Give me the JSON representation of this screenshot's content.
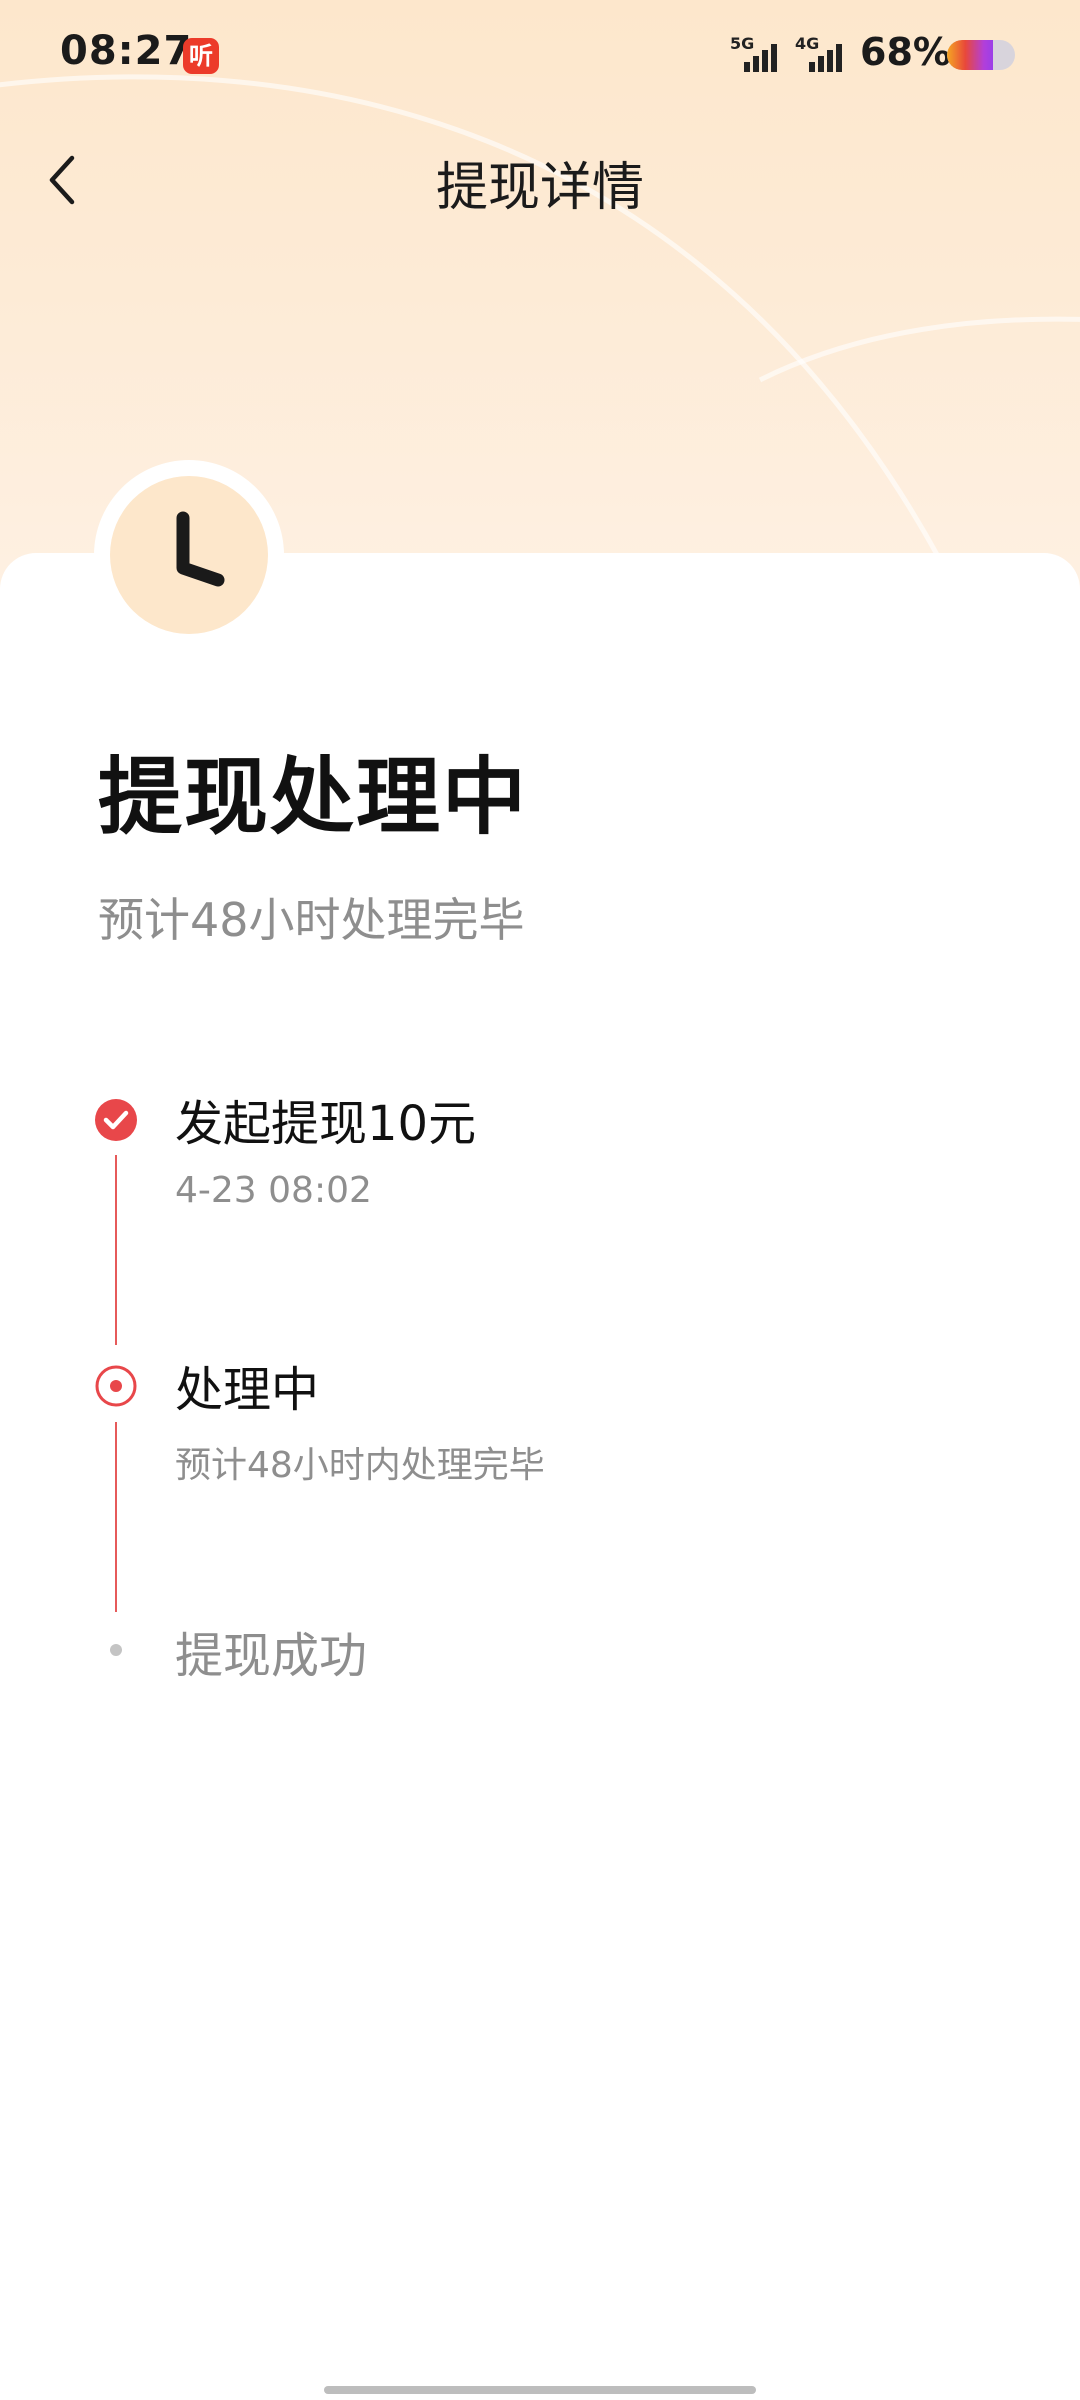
{
  "status_bar": {
    "time": "08:27",
    "app_badge": "听",
    "net1": "5G",
    "net2": "4G",
    "battery_pct": "68%",
    "battery_level": 0.68
  },
  "header": {
    "title": "提现详情"
  },
  "status": {
    "title": "提现处理中",
    "subtitle": "预计48小时处理完毕"
  },
  "timeline": [
    {
      "title": "发起提现10元",
      "sub": "4-23 08:02",
      "state": "done"
    },
    {
      "title": "处理中",
      "sub": "预计48小时内处理完毕",
      "state": "current"
    },
    {
      "title": "提现成功",
      "sub": "",
      "state": "pending"
    }
  ],
  "colors": {
    "accent": "#e8474a",
    "header_bg": "#fde7cc",
    "muted": "#8e8e8e"
  }
}
